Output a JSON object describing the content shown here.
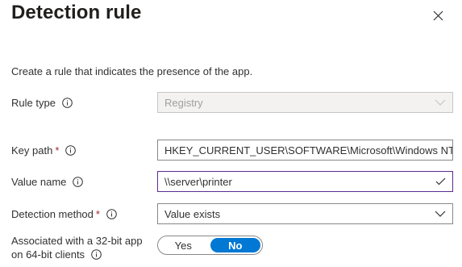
{
  "panel": {
    "title": "Detection rule",
    "description": "Create a rule that indicates the presence of the app."
  },
  "fields": {
    "rule_type": {
      "label": "Rule type",
      "value": "Registry",
      "disabled": true
    },
    "key_path": {
      "label": "Key path",
      "required": "*",
      "value": "HKEY_CURRENT_USER\\SOFTWARE\\Microsoft\\Windows NT\\C"
    },
    "value_name": {
      "label": "Value name",
      "value": "\\\\server\\printer",
      "valid": true
    },
    "detection_method": {
      "label": "Detection method",
      "required": "*",
      "value": "Value exists"
    },
    "associated_32bit": {
      "label_line1": "Associated with a 32-bit app",
      "label_line2": "on 64-bit clients",
      "options": [
        "Yes",
        "No"
      ],
      "selected": "No"
    }
  },
  "icons": {
    "close": "close-icon",
    "info": "info-icon",
    "chevron": "chevron-down-icon",
    "check": "checkmark-icon"
  },
  "colors": {
    "accent": "#0078d4",
    "focus_border": "#5c2d91",
    "required": "#a4262c",
    "disabled_bg": "#f3f2f1"
  }
}
